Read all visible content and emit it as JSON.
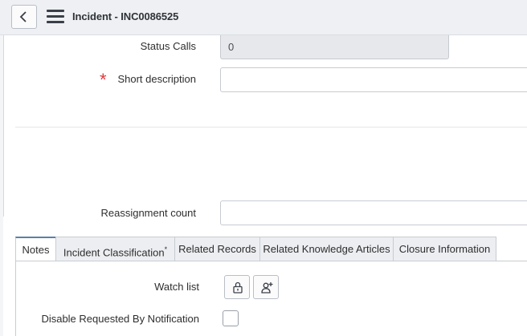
{
  "header": {
    "title": "Incident - INC0086525"
  },
  "fields": {
    "status_calls": {
      "label": "Status Calls",
      "value": "0"
    },
    "short_description": {
      "label": "Short description",
      "value": "",
      "required_mark": "*"
    },
    "reassignment_count": {
      "label": "Reassignment count",
      "value": ""
    }
  },
  "tabs": [
    {
      "label": "Notes",
      "active": true
    },
    {
      "label": "Incident Classification",
      "mandatory_mark": "*"
    },
    {
      "label": "Related Records"
    },
    {
      "label": "Related Knowledge Articles"
    },
    {
      "label": "Closure Information"
    }
  ],
  "notes": {
    "watch_list_label": "Watch list",
    "disable_notification_label": "Disable Requested By Notification",
    "disable_notification_checked": false
  },
  "colors": {
    "header_bg": "#eef0f3",
    "required": "#e0383e",
    "active_tab_accent": "#5b7fa8",
    "readonly_field": "#e6e8eb"
  },
  "icons": [
    "back-chevron-icon",
    "hamburger-menu-icon",
    "lock-icon",
    "add-user-icon"
  ]
}
